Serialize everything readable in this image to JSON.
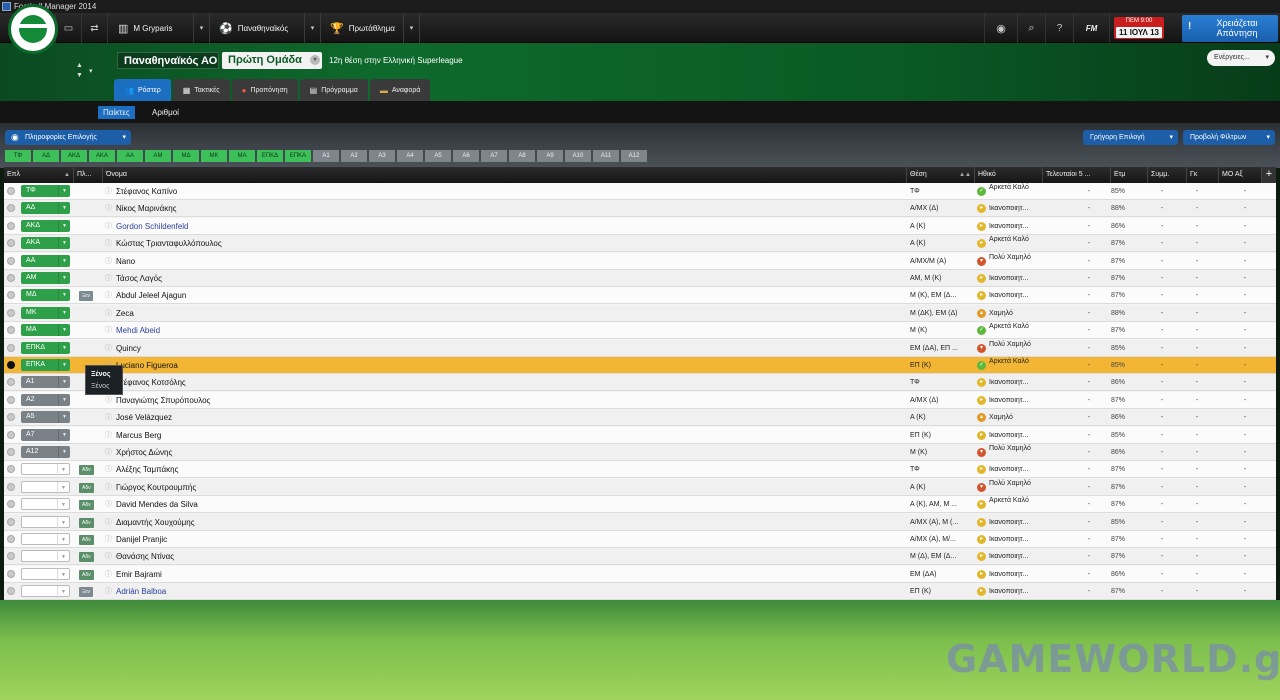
{
  "window": {
    "title": "Football Manager 2014"
  },
  "topnav": {
    "manager": "Μ Gryparis",
    "club": "Παναθηναϊκός",
    "competition": "Πρωτάθλημα",
    "fm_label": "FM",
    "date_day": "ΠΕΜ 9:00",
    "date": "11 ΙΟΥΛ 13",
    "continue_line1": "Χρειάζεται",
    "continue_line2": "Απάντηση"
  },
  "header": {
    "club_name": "Παναθηναϊκός ΑΟ",
    "team": "Πρώτη Ομάδα",
    "league_position": "12η θέση στην Ελληνική Superleague",
    "actions": "Ενέργειες..."
  },
  "tabs": [
    "Ρόστερ",
    "Τακτικές",
    "Προπόνηση",
    "Πρόγραμμα",
    "Αναφορά"
  ],
  "subtabs": [
    "Παίκτες",
    "Αριθμοί"
  ],
  "toolbar": {
    "info_button": "Πληροφορίες Επιλογής",
    "quick_select": "Γρήγορη Επιλογή",
    "filter_view": "Προβολή Φίλτρων"
  },
  "position_buttons": [
    "ΤΦ",
    "ΑΔ",
    "ΑΚΔ",
    "ΑΚΑ",
    "ΑΑ",
    "ΑΜ",
    "ΜΔ",
    "ΜΚ",
    "ΜΑ",
    "ΕΠΚΔ",
    "ΕΠΚΑ",
    "Α1",
    "Α2",
    "Α3",
    "Α4",
    "Α5",
    "Α6",
    "Α7",
    "Α8",
    "Α9",
    "Α10",
    "Α11",
    "Α12"
  ],
  "columns": {
    "sel": "Επλ",
    "status": "Πλ...",
    "name": "Όνομα",
    "position": "Θέση",
    "attitude": "Ηθικό",
    "last5": "Τελευταίοι 5 ...",
    "fitness": "Ετμ",
    "apps": "Συμμ.",
    "goals": "Γκ",
    "avg": "ΜΟ Αξ"
  },
  "players": [
    {
      "sel": "ΤΦ",
      "status": "",
      "name": "Στέφανος Καπίνο",
      "pos": "ΤΦ",
      "att": "Αρκετά Καλό",
      "att_color": "g",
      "fit": "85%"
    },
    {
      "sel": "ΑΔ",
      "status": "",
      "name": "Νίκος Μαρινάκης",
      "pos": "Α/ΜΧ (Δ)",
      "att": "Ικανοποιητ...",
      "att_color": "y",
      "fit": "88%"
    },
    {
      "sel": "ΑΚΔ",
      "status": "",
      "name": "Gordon Schildenfeld",
      "pos": "Α (Κ)",
      "att": "Ικανοποιητ...",
      "att_color": "y",
      "fit": "86%",
      "link": true
    },
    {
      "sel": "ΑΚΑ",
      "status": "",
      "name": "Κώστας Τριανταφυλλόπουλος",
      "pos": "Α (Κ)",
      "att": "Αρκετά Καλό",
      "att_color": "y",
      "fit": "87%"
    },
    {
      "sel": "ΑΑ",
      "status": "",
      "name": "Nano",
      "pos": "Α/ΜΧ/Μ (Α)",
      "att": "Πολύ Χαμηλό",
      "att_color": "r",
      "fit": "87%"
    },
    {
      "sel": "ΑΜ",
      "status": "",
      "name": "Τάσος Λαγός",
      "pos": "ΑΜ, Μ (Κ)",
      "att": "Ικανοποιητ...",
      "att_color": "y",
      "fit": "87%"
    },
    {
      "sel": "ΜΔ",
      "status": "Ξεν",
      "name": "Abdul Jeleel Ajagun",
      "pos": "Μ (Κ), ΕΜ (Δ...",
      "att": "Ικανοποιητ...",
      "att_color": "y",
      "fit": "87%"
    },
    {
      "sel": "ΜΚ",
      "status": "",
      "name": "Zeca",
      "pos": "Μ (ΔΚ), ΕΜ (Δ)",
      "att": "Χαμηλό",
      "att_color": "o",
      "fit": "88%"
    },
    {
      "sel": "ΜΑ",
      "status": "",
      "name": "Mehdi Abeid",
      "pos": "Μ (Κ)",
      "att": "Αρκετά Καλό",
      "att_color": "g",
      "fit": "87%",
      "link": true
    },
    {
      "sel": "ΕΠΚΔ",
      "status": "",
      "name": "Quincy",
      "pos": "ΕΜ (ΔΑ), ΕΠ ...",
      "att": "Πολύ Χαμηλό",
      "att_color": "r",
      "fit": "85%"
    },
    {
      "sel": "ΕΠΚΑ",
      "status": "",
      "name": "Luciano Figueroa",
      "pos": "ΕΠ (Κ)",
      "att": "Αρκετά Καλό",
      "att_color": "g",
      "fit": "85%",
      "highlight": true
    },
    {
      "sel": "Α1",
      "status": "",
      "name": "Στέφανος Κοτσόλης",
      "pos": "ΤΦ",
      "att": "Ικανοποιητ...",
      "att_color": "y",
      "fit": "86%",
      "grey": true
    },
    {
      "sel": "Α2",
      "status": "",
      "name": "Παναγιώτης Σπυρόπουλος",
      "pos": "Α/ΜΧ (Δ)",
      "att": "Ικανοποιητ...",
      "att_color": "y",
      "fit": "87%",
      "grey": true
    },
    {
      "sel": "Α5",
      "status": "",
      "name": "José Velázquez",
      "pos": "Α (Κ)",
      "att": "Χαμηλό",
      "att_color": "o",
      "fit": "86%",
      "grey": true
    },
    {
      "sel": "Α7",
      "status": "",
      "name": "Marcus Berg",
      "pos": "ΕΠ (Κ)",
      "att": "Ικανοποιητ...",
      "att_color": "y",
      "fit": "85%",
      "grey": true
    },
    {
      "sel": "Α12",
      "status": "",
      "name": "Χρήστος Δώνης",
      "pos": "Μ (Κ)",
      "att": "Πολύ Χαμηλό",
      "att_color": "r",
      "fit": "86%",
      "grey": true
    },
    {
      "sel": "",
      "status": "Αδν",
      "name": "Αλέξης Ταμπάκης",
      "pos": "ΤΦ",
      "att": "Ικανοποιητ...",
      "att_color": "y",
      "fit": "87%"
    },
    {
      "sel": "",
      "status": "Αδν",
      "name": "Γιώργος Κουτρουμπής",
      "pos": "Α (Κ)",
      "att": "Πολύ Χαμηλό",
      "att_color": "r",
      "fit": "87%"
    },
    {
      "sel": "",
      "status": "Αδν",
      "name": "David Mendes da Silva",
      "pos": "Α (Κ), ΑΜ, Μ ...",
      "att": "Αρκετά Καλό",
      "att_color": "y",
      "fit": "87%"
    },
    {
      "sel": "",
      "status": "Αδν",
      "name": "Διαμαντής Χουχούμης",
      "pos": "Α/ΜΧ (Α), Μ (...",
      "att": "Ικανοποιητ...",
      "att_color": "y",
      "fit": "85%"
    },
    {
      "sel": "",
      "status": "Αδν",
      "name": "Danijel Pranjic",
      "pos": "Α/ΜΧ (Α), Μ/...",
      "att": "Ικανοποιητ...",
      "att_color": "y",
      "fit": "87%"
    },
    {
      "sel": "",
      "status": "Αδν",
      "name": "Θανάσης Ντίνας",
      "pos": "Μ (Δ), ΕΜ (Δ...",
      "att": "Ικανοποιητ...",
      "att_color": "y",
      "fit": "87%"
    },
    {
      "sel": "",
      "status": "Αδν",
      "name": "Emir Bajrami",
      "pos": "ΕΜ (ΔΑ)",
      "att": "Ικανοποιητ...",
      "att_color": "y",
      "fit": "86%"
    },
    {
      "sel": "",
      "status": "Ξεν",
      "name": "Adrián Balboa",
      "pos": "ΕΠ (Κ)",
      "att": "Ικανοποιητ...",
      "att_color": "y",
      "fit": "87%",
      "link": true
    }
  ],
  "dash": "-",
  "tooltip": {
    "line1": "Ξένος",
    "line2": "Ξένος"
  },
  "watermark": "GAMEWORLD.gr"
}
